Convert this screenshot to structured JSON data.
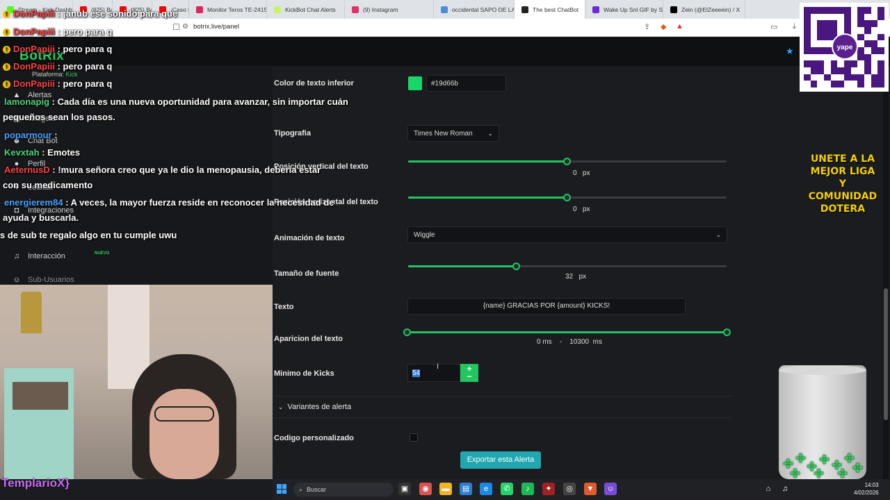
{
  "browser": {
    "tabs": [
      {
        "label": "Stream - Kick Dashb",
        "color": "#53fc18"
      },
      {
        "label": "(825) Bauro Alejan",
        "color": "#ff0000"
      },
      {
        "label": "(825) Bauro Alejan",
        "color": "#ff0000"
      },
      {
        "label": "¡Caso BEBA a",
        "color": "#ff0000"
      },
      {
        "label": "Monitor Teros TE-2415",
        "color": "#e0245e"
      },
      {
        "label": "KickBot Chat Alerts",
        "color": "#c7f464"
      },
      {
        "label": "(9) Instagram",
        "color": "#e1306c"
      },
      {
        "label": "occidental SAPO DE LA",
        "color": "#4a90d9"
      },
      {
        "label": "The best ChatBot",
        "color": "#222222",
        "active": true
      },
      {
        "label": "Wake Up Snl GIF by Sa",
        "color": "#6c2bd9"
      },
      {
        "label": "Zein (@ElZeeeein) / X",
        "color": "#000000"
      }
    ],
    "url": "botrix.live/panel"
  },
  "sidebar": {
    "brand": "BotRix",
    "platform_label": "Plataforma:",
    "platform_value": "Kick",
    "items": [
      {
        "label": "Alertas",
        "icon": "bell-icon"
      },
      {
        "label": "Widgets",
        "icon": "widget-icon"
      },
      {
        "label": "Chat Bot",
        "icon": "robot-icon"
      },
      {
        "label": "Perfil",
        "icon": "user-icon"
      },
      {
        "label": "Lealtad",
        "icon": "heart-icon"
      },
      {
        "label": "Integraciones",
        "icon": "plug-icon"
      },
      {
        "label": "Interacción",
        "icon": "music-icon"
      },
      {
        "label": "Sub-Usuarios",
        "icon": "users-icon"
      }
    ],
    "badge_new": "NUEVO"
  },
  "chat": [
    {
      "user": "DonPapiii",
      "text": ": ¡anub ese sonido para que",
      "color": "red",
      "badge": true
    },
    {
      "user": "DonPapiii",
      "text": ": pero para q",
      "color": "red",
      "badge": true
    },
    {
      "user": "DonPapiii",
      "text": ": pero para q",
      "color": "red",
      "badge": true
    },
    {
      "user": "DonPapiii",
      "text": ": pero para q",
      "color": "red",
      "badge": true
    },
    {
      "user": "DonPapiii",
      "text": ": pero para q",
      "color": "red",
      "badge": true
    },
    {
      "user": "lamonapig",
      "text": ": Cada día es una nueva oportunidad para avanzar, sin importar cuán",
      "color": "green",
      "badge": false
    },
    {
      "user": "",
      "text": "pequeños sean los pasos.",
      "color": "",
      "badge": false
    },
    {
      "user": "poparmour",
      "text": ":",
      "color": "blue",
      "badge": false
    },
    {
      "user": "Kevxtah",
      "text": ": Emotes",
      "color": "green",
      "badge": false
    },
    {
      "user": "AeternusD",
      "text": ": !mura señora creo que ya le dio la menopausia, debería estar",
      "color": "red",
      "badge": false
    },
    {
      "user": "",
      "text": "con su medicamento",
      "color": "",
      "badge": false
    },
    {
      "user": "energierem84",
      "text": ": A veces, la mayor fuerza reside en reconocer la necesidad de",
      "color": "blue",
      "badge": false
    },
    {
      "user": "",
      "text": "ayuda y buscarla.",
      "color": "",
      "badge": false
    },
    {
      "user": "",
      "text": "s de sub te regalo algo en tu cumple uwu",
      "color": "",
      "badge": false
    }
  ],
  "form": {
    "color_label": "Color de texto inferior",
    "color_value": "#19d66b",
    "font_label": "Tipografia",
    "font_value": "Times New Roman",
    "vpos_label": "Posición vertical del texto",
    "vpos_value": "0",
    "vpos_unit": "px",
    "vpos_fraction": 0.5,
    "hpos_label": "Posición horizontal del texto",
    "hpos_value": "0",
    "hpos_unit": "px",
    "hpos_fraction": 0.5,
    "anim_label": "Animación de texto",
    "anim_value": "Wiggle",
    "size_label": "Tamaño de fuente",
    "size_value": "32",
    "size_unit": "px",
    "size_fraction": 0.34,
    "text_label": "Texto",
    "text_value": "{name} GRACIAS POR  {amount} KICKS!",
    "appear_label": "Aparicion del texto",
    "appear_from": "0",
    "appear_sep": "-",
    "appear_to": "10300",
    "appear_unit": "ms",
    "kicks_label": "Minimo de Kicks",
    "kicks_value": "54",
    "stepper_plus": "+",
    "stepper_minus": "−",
    "variants_label": "Variantes de alerta",
    "custom_code_label": "Codigo personalizado",
    "export_label": "Exportar esta Alerta"
  },
  "overlay": {
    "yape": "yape",
    "promo": "UNETE A LA MEJOR LIGA Y COMUNIDAD DOTERA",
    "cam_name": "TemplarioX}"
  },
  "taskbar": {
    "search_placeholder": "Buscar",
    "time": "14:03",
    "date": "4/02/2026"
  },
  "colors": {
    "accent": "#22c55e",
    "export": "#20a7b0",
    "promo": "#f5d200"
  }
}
